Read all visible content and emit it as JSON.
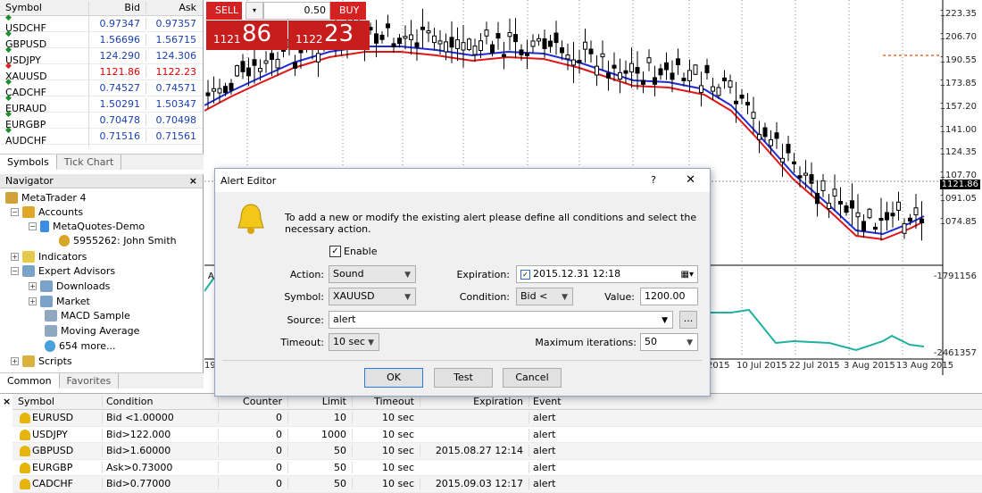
{
  "market_watch": {
    "headers": [
      "Symbol",
      "Bid",
      "Ask"
    ],
    "rows": [
      {
        "symbol": "USDCHF",
        "bid": "0.97347",
        "ask": "0.97357",
        "dir": "up"
      },
      {
        "symbol": "GBPUSD",
        "bid": "1.56696",
        "ask": "1.56715",
        "dir": "up"
      },
      {
        "symbol": "USDJPY",
        "bid": "124.290",
        "ask": "124.306",
        "dir": "up"
      },
      {
        "symbol": "XAUUSD",
        "bid": "1121.86",
        "ask": "1122.23",
        "dir": "down"
      },
      {
        "symbol": "CADCHF",
        "bid": "0.74527",
        "ask": "0.74571",
        "dir": "up"
      },
      {
        "symbol": "EURAUD",
        "bid": "1.50291",
        "ask": "1.50347",
        "dir": "up"
      },
      {
        "symbol": "EURGBP",
        "bid": "0.70478",
        "ask": "0.70498",
        "dir": "up"
      },
      {
        "symbol": "AUDCHF",
        "bid": "0.71516",
        "ask": "0.71561",
        "dir": "up"
      }
    ],
    "tabs": [
      "Symbols",
      "Tick Chart"
    ]
  },
  "navigator": {
    "title": "Navigator",
    "close": "×",
    "items": [
      "MetaTrader 4",
      "Accounts",
      "MetaQuotes-Demo",
      "5955262: John Smith",
      "Indicators",
      "Expert Advisors",
      "Downloads",
      "Market",
      "MACD Sample",
      "Moving Average",
      "654 more...",
      "Scripts"
    ],
    "tabs": [
      "Common",
      "Favorites"
    ]
  },
  "order_panel": {
    "sell_label": "SELL",
    "buy_label": "BUY",
    "volume": "0.50",
    "sell_small": "1121",
    "sell_big": "86",
    "buy_small": "1122",
    "buy_big": "23"
  },
  "chart": {
    "price_labels": [
      "1223.35",
      "1206.70",
      "1190.55",
      "1173.85",
      "1157.20",
      "1141.00",
      "1124.35",
      "1107.70",
      "1091.05",
      "1074.85"
    ],
    "current_price": "1121.86",
    "indicator_labels": [
      "-1791156",
      "-2461357"
    ],
    "date_labels": [
      "19",
      "2015",
      "10 Jul 2015",
      "22 Jul 2015",
      "3 Aug 2015",
      "13 Aug 2015"
    ],
    "indicator_short": "A"
  },
  "dialog": {
    "title": "Alert Editor",
    "help": "?",
    "close": "✕",
    "message": "To add a new or modify the existing alert please define all conditions and select the necessary action.",
    "enable_label": "Enable",
    "action_label": "Action:",
    "action_value": "Sound",
    "symbol_label": "Symbol:",
    "symbol_value": "XAUUSD",
    "source_label": "Source:",
    "source_value": "alert",
    "timeout_label": "Timeout:",
    "timeout_value": "10 sec",
    "expiration_label": "Expiration:",
    "expiration_value": "2015.12.31 12:18",
    "condition_label": "Condition:",
    "condition_value": "Bid <",
    "value_label": "Value:",
    "value_value": "1200.00",
    "max_iter_label": "Maximum iterations:",
    "max_iter_value": "50",
    "browse": "...",
    "ok": "OK",
    "test": "Test",
    "cancel": "Cancel"
  },
  "alerts": {
    "headers": [
      "Symbol",
      "Condition",
      "Counter",
      "Limit",
      "Timeout",
      "Expiration",
      "Event"
    ],
    "rows": [
      [
        "EURUSD",
        "Bid <1.00000",
        "0",
        "10",
        "10 sec",
        "",
        "alert"
      ],
      [
        "USDJPY",
        "Bid>122.000",
        "0",
        "1000",
        "10 sec",
        "",
        "alert"
      ],
      [
        "GBPUSD",
        "Bid>1.60000",
        "0",
        "50",
        "10 sec",
        "2015.08.27 12:14",
        "alert"
      ],
      [
        "EURGBP",
        "Ask>0.73000",
        "0",
        "50",
        "10 sec",
        "",
        "alert"
      ],
      [
        "CADCHF",
        "Bid>0.77000",
        "0",
        "50",
        "10 sec",
        "2015.09.03 12:17",
        "alert"
      ]
    ],
    "close": "×"
  },
  "colors": {
    "sell": "#d42121",
    "buy": "#d42121",
    "ma_blue": "#1f2bd9",
    "ma_red": "#e01515",
    "osc": "#21b0a0"
  }
}
